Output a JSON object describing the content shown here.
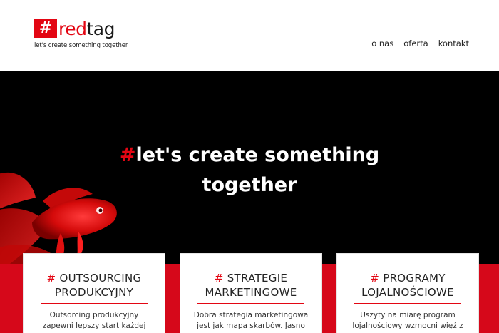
{
  "brand": {
    "badge": "#",
    "word_prefix": "red",
    "word_suffix": "tag",
    "tagline": "let's create something together"
  },
  "nav": {
    "items": [
      {
        "label": "o nas"
      },
      {
        "label": "oferta"
      },
      {
        "label": "kontakt"
      }
    ]
  },
  "hero": {
    "hash": "#",
    "line1": "let's create something",
    "line2": "together"
  },
  "cards": [
    {
      "hash": "#",
      "title_line1": "OUTSOURCING",
      "title_line2": "PRODUKCYJNY",
      "text_line1": "Outsorcing produkcyjny",
      "text_line2": "zapewni lepszy start każdej"
    },
    {
      "hash": "#",
      "title_line1": "STRATEGIE",
      "title_line2": "MARKETINGOWE",
      "text_line1": "Dobra strategia marketingowa",
      "text_line2": "jest jak mapa skarbów. Jasno"
    },
    {
      "hash": "#",
      "title_line1": "PROGRAMY",
      "title_line2": "LOJALNOŚCIOWE",
      "text_line1": "Uszyty na miarę program",
      "text_line2": "lojalnościowy wzmocni więź z"
    }
  ],
  "colors": {
    "accent": "#e30613",
    "hero_bg": "#000000",
    "band": "#d6081a"
  }
}
